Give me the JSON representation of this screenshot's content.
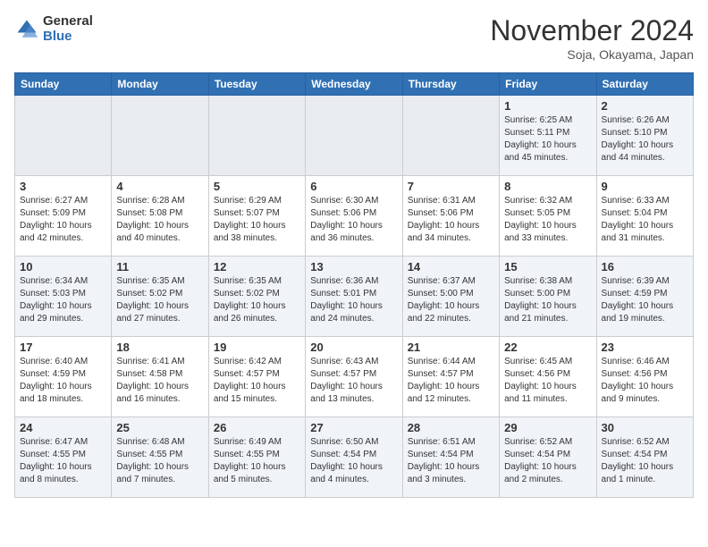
{
  "header": {
    "logo_general": "General",
    "logo_blue": "Blue",
    "month_title": "November 2024",
    "location": "Soja, Okayama, Japan"
  },
  "weekdays": [
    "Sunday",
    "Monday",
    "Tuesday",
    "Wednesday",
    "Thursday",
    "Friday",
    "Saturday"
  ],
  "weeks": [
    [
      {
        "day": "",
        "info": ""
      },
      {
        "day": "",
        "info": ""
      },
      {
        "day": "",
        "info": ""
      },
      {
        "day": "",
        "info": ""
      },
      {
        "day": "",
        "info": ""
      },
      {
        "day": "1",
        "info": "Sunrise: 6:25 AM\nSunset: 5:11 PM\nDaylight: 10 hours\nand 45 minutes."
      },
      {
        "day": "2",
        "info": "Sunrise: 6:26 AM\nSunset: 5:10 PM\nDaylight: 10 hours\nand 44 minutes."
      }
    ],
    [
      {
        "day": "3",
        "info": "Sunrise: 6:27 AM\nSunset: 5:09 PM\nDaylight: 10 hours\nand 42 minutes."
      },
      {
        "day": "4",
        "info": "Sunrise: 6:28 AM\nSunset: 5:08 PM\nDaylight: 10 hours\nand 40 minutes."
      },
      {
        "day": "5",
        "info": "Sunrise: 6:29 AM\nSunset: 5:07 PM\nDaylight: 10 hours\nand 38 minutes."
      },
      {
        "day": "6",
        "info": "Sunrise: 6:30 AM\nSunset: 5:06 PM\nDaylight: 10 hours\nand 36 minutes."
      },
      {
        "day": "7",
        "info": "Sunrise: 6:31 AM\nSunset: 5:06 PM\nDaylight: 10 hours\nand 34 minutes."
      },
      {
        "day": "8",
        "info": "Sunrise: 6:32 AM\nSunset: 5:05 PM\nDaylight: 10 hours\nand 33 minutes."
      },
      {
        "day": "9",
        "info": "Sunrise: 6:33 AM\nSunset: 5:04 PM\nDaylight: 10 hours\nand 31 minutes."
      }
    ],
    [
      {
        "day": "10",
        "info": "Sunrise: 6:34 AM\nSunset: 5:03 PM\nDaylight: 10 hours\nand 29 minutes."
      },
      {
        "day": "11",
        "info": "Sunrise: 6:35 AM\nSunset: 5:02 PM\nDaylight: 10 hours\nand 27 minutes."
      },
      {
        "day": "12",
        "info": "Sunrise: 6:35 AM\nSunset: 5:02 PM\nDaylight: 10 hours\nand 26 minutes."
      },
      {
        "day": "13",
        "info": "Sunrise: 6:36 AM\nSunset: 5:01 PM\nDaylight: 10 hours\nand 24 minutes."
      },
      {
        "day": "14",
        "info": "Sunrise: 6:37 AM\nSunset: 5:00 PM\nDaylight: 10 hours\nand 22 minutes."
      },
      {
        "day": "15",
        "info": "Sunrise: 6:38 AM\nSunset: 5:00 PM\nDaylight: 10 hours\nand 21 minutes."
      },
      {
        "day": "16",
        "info": "Sunrise: 6:39 AM\nSunset: 4:59 PM\nDaylight: 10 hours\nand 19 minutes."
      }
    ],
    [
      {
        "day": "17",
        "info": "Sunrise: 6:40 AM\nSunset: 4:59 PM\nDaylight: 10 hours\nand 18 minutes."
      },
      {
        "day": "18",
        "info": "Sunrise: 6:41 AM\nSunset: 4:58 PM\nDaylight: 10 hours\nand 16 minutes."
      },
      {
        "day": "19",
        "info": "Sunrise: 6:42 AM\nSunset: 4:57 PM\nDaylight: 10 hours\nand 15 minutes."
      },
      {
        "day": "20",
        "info": "Sunrise: 6:43 AM\nSunset: 4:57 PM\nDaylight: 10 hours\nand 13 minutes."
      },
      {
        "day": "21",
        "info": "Sunrise: 6:44 AM\nSunset: 4:57 PM\nDaylight: 10 hours\nand 12 minutes."
      },
      {
        "day": "22",
        "info": "Sunrise: 6:45 AM\nSunset: 4:56 PM\nDaylight: 10 hours\nand 11 minutes."
      },
      {
        "day": "23",
        "info": "Sunrise: 6:46 AM\nSunset: 4:56 PM\nDaylight: 10 hours\nand 9 minutes."
      }
    ],
    [
      {
        "day": "24",
        "info": "Sunrise: 6:47 AM\nSunset: 4:55 PM\nDaylight: 10 hours\nand 8 minutes."
      },
      {
        "day": "25",
        "info": "Sunrise: 6:48 AM\nSunset: 4:55 PM\nDaylight: 10 hours\nand 7 minutes."
      },
      {
        "day": "26",
        "info": "Sunrise: 6:49 AM\nSunset: 4:55 PM\nDaylight: 10 hours\nand 5 minutes."
      },
      {
        "day": "27",
        "info": "Sunrise: 6:50 AM\nSunset: 4:54 PM\nDaylight: 10 hours\nand 4 minutes."
      },
      {
        "day": "28",
        "info": "Sunrise: 6:51 AM\nSunset: 4:54 PM\nDaylight: 10 hours\nand 3 minutes."
      },
      {
        "day": "29",
        "info": "Sunrise: 6:52 AM\nSunset: 4:54 PM\nDaylight: 10 hours\nand 2 minutes."
      },
      {
        "day": "30",
        "info": "Sunrise: 6:52 AM\nSunset: 4:54 PM\nDaylight: 10 hours\nand 1 minute."
      }
    ]
  ]
}
